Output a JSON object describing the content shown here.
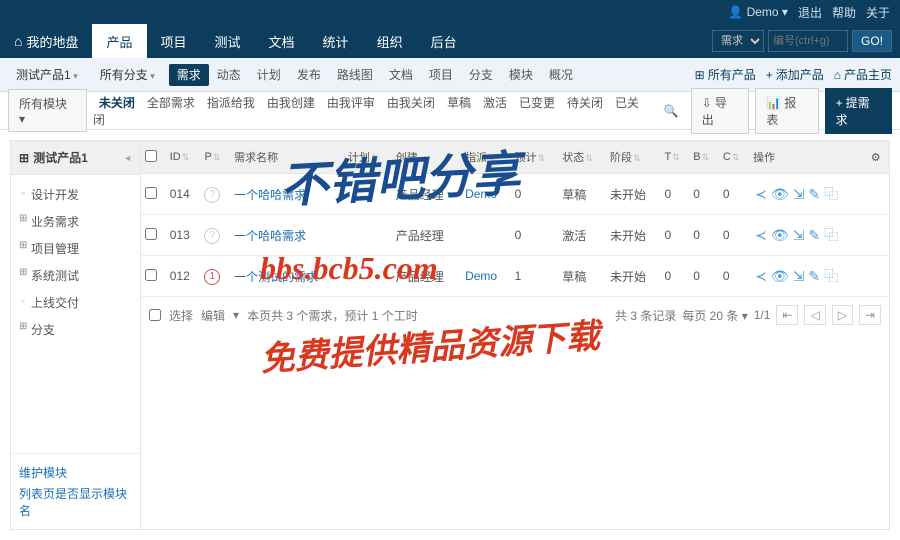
{
  "topbar": {
    "user": "Demo",
    "logout": "退出",
    "help": "帮助",
    "about": "关于"
  },
  "mainnav": {
    "items": [
      {
        "label": "我的地盘",
        "active": false,
        "home": true
      },
      {
        "label": "产品",
        "active": true
      },
      {
        "label": "项目",
        "active": false
      },
      {
        "label": "测试",
        "active": false
      },
      {
        "label": "文档",
        "active": false
      },
      {
        "label": "统计",
        "active": false
      },
      {
        "label": "组织",
        "active": false
      },
      {
        "label": "后台",
        "active": false
      }
    ]
  },
  "search": {
    "type": "需求",
    "placeholder": "编号(ctrl+g)",
    "go": "GO!"
  },
  "subnav": {
    "product": "测试产品1",
    "branch": "所有分支",
    "items": [
      {
        "label": "需求",
        "active": true
      },
      {
        "label": "动态"
      },
      {
        "label": "计划"
      },
      {
        "label": "发布"
      },
      {
        "label": "路线图"
      },
      {
        "label": "文档"
      },
      {
        "label": "项目"
      },
      {
        "label": "分支"
      },
      {
        "label": "模块"
      },
      {
        "label": "概况"
      }
    ],
    "right": [
      {
        "label": "所有产品"
      },
      {
        "label": "添加产品"
      },
      {
        "label": "产品主页"
      }
    ]
  },
  "filters": {
    "module": "所有模块",
    "items": [
      {
        "label": "未关闭",
        "active": true
      },
      {
        "label": "全部需求"
      },
      {
        "label": "指派给我"
      },
      {
        "label": "由我创建"
      },
      {
        "label": "由我评审"
      },
      {
        "label": "由我关闭"
      },
      {
        "label": "草稿"
      },
      {
        "label": "激活"
      },
      {
        "label": "已变更"
      },
      {
        "label": "待关闭"
      },
      {
        "label": "已关闭"
      }
    ],
    "right": [
      {
        "label": "导出"
      },
      {
        "label": "报表"
      },
      {
        "label": "提需求",
        "primary": true
      }
    ]
  },
  "sidebar": {
    "title": "测试产品1",
    "tree": [
      {
        "label": "设计开发",
        "type": "leaf"
      },
      {
        "label": "业务需求",
        "type": "branch"
      },
      {
        "label": "项目管理",
        "type": "branch"
      },
      {
        "label": "系统测试",
        "type": "branch"
      },
      {
        "label": "上线交付",
        "type": "leaf"
      },
      {
        "label": "分支",
        "type": "branch"
      }
    ],
    "links": {
      "maintain": "维护模块",
      "toggle": "列表页是否显示模块名"
    }
  },
  "table": {
    "cols": [
      "",
      "ID",
      "P",
      "需求名称",
      "计划",
      "创建",
      "指派",
      "预计",
      "状态",
      "阶段",
      "T",
      "B",
      "C",
      "操作",
      ""
    ],
    "rows": [
      {
        "id": "014",
        "p": "?",
        "title": "一个哈哈需求",
        "plan": "",
        "creator": "产品经理",
        "assign": "Demo",
        "est": "0",
        "status": "草稿",
        "stage": "未开始",
        "t": "0",
        "b": "0",
        "c": "0"
      },
      {
        "id": "013",
        "p": "?",
        "title": "一个哈哈需求",
        "plan": "",
        "creator": "产品经理",
        "assign": "",
        "est": "0",
        "status": "激活",
        "stage": "未开始",
        "t": "0",
        "b": "0",
        "c": "0"
      },
      {
        "id": "012",
        "p": "1",
        "hot": true,
        "title": "一个测试的需求",
        "plan": "",
        "creator": "产品经理",
        "assign": "Demo",
        "est": "1",
        "status": "草稿",
        "stage": "未开始",
        "t": "0",
        "b": "0",
        "c": "0"
      }
    ],
    "footer": {
      "select": "选择",
      "edit": "编辑",
      "summary": "本页共 3 个需求，预计 1 个工时",
      "total": "共 3 条记录",
      "perpage": "每页 20 条",
      "page": "1/1"
    }
  },
  "watermark": {
    "t1": "不错吧分享",
    "t2": "bbs.bcb5.com",
    "t3": "免费提供精品资源下载"
  }
}
